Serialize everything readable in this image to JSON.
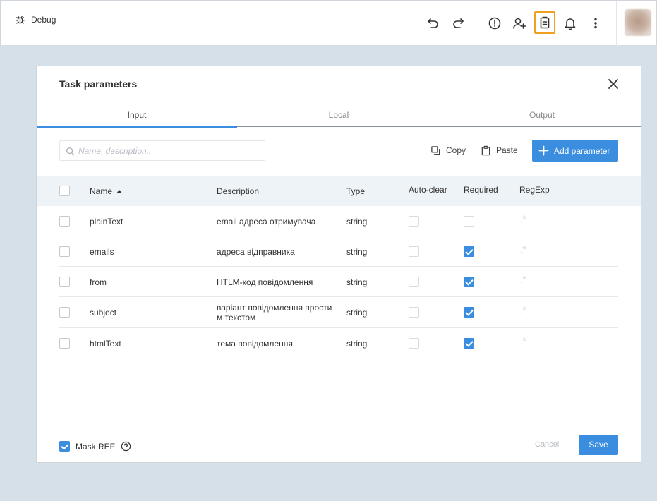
{
  "topbar": {
    "app_label": "Debug",
    "icons": [
      "bug-icon",
      "undo-icon",
      "redo-icon",
      "alert-icon",
      "add-user-icon",
      "clipboard-icon",
      "bell-icon",
      "more-vertical-icon"
    ],
    "active_icon": "clipboard-icon"
  },
  "dialog": {
    "title": "Task parameters",
    "tabs": [
      {
        "label": "Input",
        "active": true
      },
      {
        "label": "Local",
        "active": false
      },
      {
        "label": "Output",
        "active": false
      }
    ],
    "search": {
      "placeholder": "Name, description...",
      "value": ""
    },
    "actions": {
      "copy_label": "Copy",
      "paste_label": "Paste",
      "add_label": "Add parameter"
    },
    "columns": {
      "name": "Name",
      "description": "Description",
      "type": "Type",
      "auto_clear": "Auto-clear",
      "required": "Required",
      "regexp": "RegExp"
    },
    "sort": {
      "column": "Name",
      "direction": "ascending"
    },
    "rows": [
      {
        "name": "plainText",
        "description": "email адреса отримувача",
        "description2": "",
        "type": "string",
        "auto_clear": false,
        "required": false,
        "regexp_glyph": ".*"
      },
      {
        "name": "emails",
        "description": "адреса відправника",
        "description2": "",
        "type": "string",
        "auto_clear": false,
        "required": true,
        "regexp_glyph": ".*"
      },
      {
        "name": "from",
        "description": "HTLM-код повідомлення",
        "description2": "",
        "type": "string",
        "auto_clear": false,
        "required": true,
        "regexp_glyph": ".*"
      },
      {
        "name": "subject",
        "description": "варіант повідомлення прости",
        "description2": "м текстом",
        "type": "string",
        "auto_clear": false,
        "required": true,
        "regexp_glyph": ".*"
      },
      {
        "name": "htmlText",
        "description": "тема повідомлення",
        "description2": "",
        "type": "string",
        "auto_clear": false,
        "required": true,
        "regexp_glyph": ".*"
      }
    ],
    "footer": {
      "mask_label": "Mask REF",
      "mask_checked": true,
      "cancel_label": "Cancel",
      "save_label": "Save"
    }
  },
  "colors": {
    "accent": "#3a8ddf",
    "highlight_border": "#f0a020",
    "background": "#d6e0e8"
  }
}
